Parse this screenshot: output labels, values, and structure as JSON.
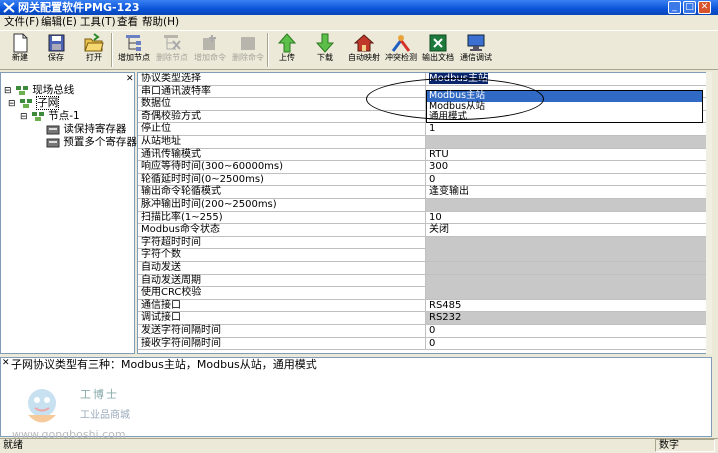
{
  "window": {
    "title": "网关配置软件PMG-123"
  },
  "menu": [
    {
      "label": "文件(F)"
    },
    {
      "label": "编辑(E)"
    },
    {
      "label": "工具(T)"
    },
    {
      "label": "查看"
    },
    {
      "label": "帮助(H)"
    }
  ],
  "toolbar": {
    "new": "新建",
    "save": "保存",
    "open": "打开",
    "add_node": "增加节点",
    "delete_node": "删除节点",
    "add_cmd": "增加命令",
    "delete_cmd": "删除命令",
    "upload": "上传",
    "download": "下载",
    "auto_map": "自动映射",
    "conflict_check": "冲突检测",
    "export_doc": "输出文档",
    "comm_debug": "通信调试"
  },
  "tree": {
    "root": "现场总线",
    "subnet": "子网",
    "node": "节点-1",
    "commands": [
      "读保持寄存器",
      "预置多个寄存器"
    ]
  },
  "grid": {
    "rows": [
      {
        "name": "协议类型选择",
        "value": "Modbus主站",
        "state": "selected"
      },
      {
        "name": "串口通讯波特率",
        "value": "",
        "state": "normal"
      },
      {
        "name": "数据位",
        "value": "",
        "state": "normal"
      },
      {
        "name": "奇偶校验方式",
        "value": "",
        "state": "normal"
      },
      {
        "name": "停止位",
        "value": "1",
        "state": "normal"
      },
      {
        "name": "从站地址",
        "value": "",
        "state": "disabled"
      },
      {
        "name": "通讯传输模式",
        "value": "RTU",
        "state": "normal"
      },
      {
        "name": "响应等待时间(300~60000ms)",
        "value": "300",
        "state": "normal"
      },
      {
        "name": "轮循延时时间(0~2500ms)",
        "value": "0",
        "state": "normal"
      },
      {
        "name": "输出命令轮循模式",
        "value": "逢变输出",
        "state": "normal"
      },
      {
        "name": "脉冲输出时间(200~2500ms)",
        "value": "",
        "state": "disabled"
      },
      {
        "name": "扫描比率(1~255)",
        "value": "10",
        "state": "normal"
      },
      {
        "name": "Modbus命令状态",
        "value": "关闭",
        "state": "normal"
      },
      {
        "name": "字符超时时间",
        "value": "",
        "state": "disabled"
      },
      {
        "name": "字符个数",
        "value": "",
        "state": "disabled"
      },
      {
        "name": "自动发送",
        "value": "",
        "state": "disabled"
      },
      {
        "name": "自动发送周期",
        "value": "",
        "state": "disabled"
      },
      {
        "name": "使用CRC校验",
        "value": "",
        "state": "disabled"
      },
      {
        "name": "通信接口",
        "value": "RS485",
        "state": "normal"
      },
      {
        "name": "调试接口",
        "value": "RS232",
        "state": "disabled"
      },
      {
        "name": "发送字符间隔时间",
        "value": "0",
        "state": "normal"
      },
      {
        "name": "接收字符间隔时间",
        "value": "0",
        "state": "normal"
      }
    ]
  },
  "dropdown": {
    "options": [
      "Modbus主站",
      "Modbus从站",
      "通用模式"
    ],
    "selected": "Modbus主站"
  },
  "description": "子网协议类型有三种：Modbus主站，Modbus从站，通用模式",
  "watermark": {
    "brand": "工博士",
    "sub": "工业品商城",
    "url": "www.gongboshi.com"
  },
  "status": {
    "left": "就绪",
    "right": "数字"
  },
  "colors": {
    "title_bar": "#0a53d8",
    "selection": "#0a246a",
    "disabled_cell": "#c8c8c8"
  }
}
